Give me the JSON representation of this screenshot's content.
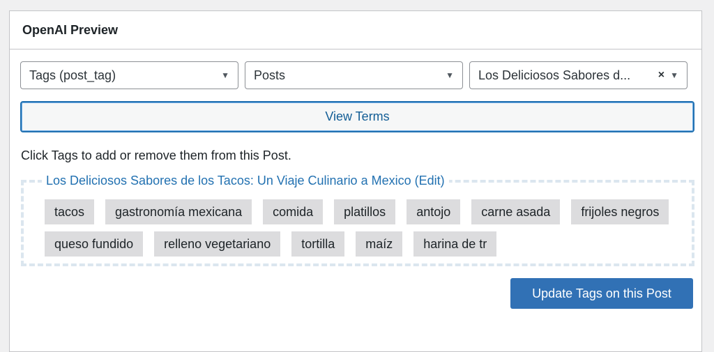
{
  "panel": {
    "title": "OpenAI Preview"
  },
  "selects": {
    "taxonomy": "Tags (post_tag)",
    "post_type": "Posts",
    "post": "Los Deliciosos Sabores d..."
  },
  "view_terms_label": "View Terms",
  "help_text": "Click Tags to add or remove them from this Post.",
  "post_link": "Los Deliciosos Sabores de los Tacos: Un Viaje Culinario a Mexico (Edit)",
  "tags": [
    "tacos",
    "gastronomía mexicana",
    "comida",
    "platillos",
    "antojo",
    "carne asada",
    "frijoles negros",
    "queso fundido",
    "relleno vegetariano",
    "tortilla",
    "maíz",
    "harina de tr"
  ],
  "update_label": "Update Tags on this Post",
  "icons": {
    "arrow": "▼",
    "clear": "×"
  }
}
